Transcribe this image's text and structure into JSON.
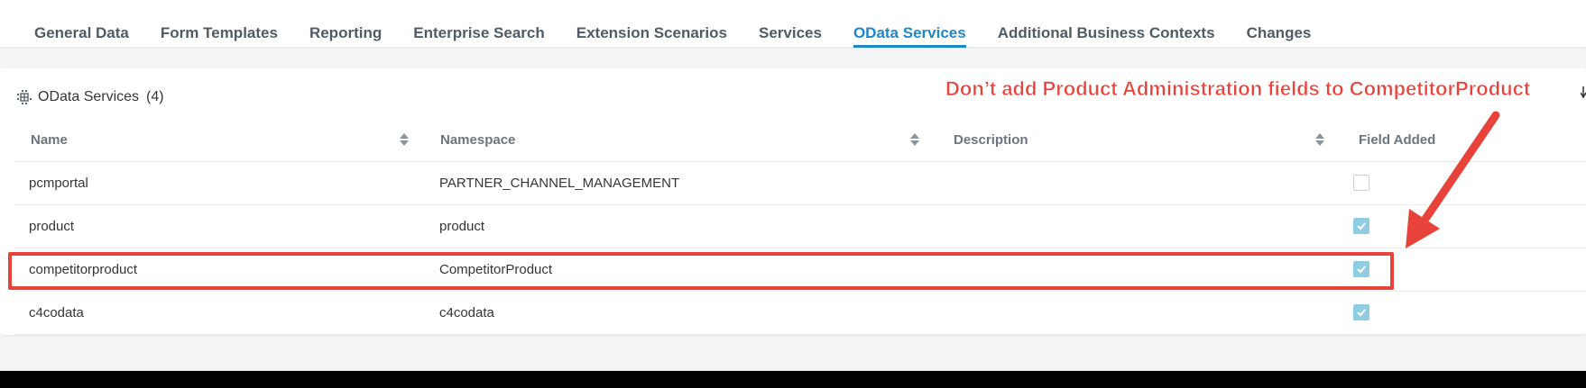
{
  "tabs": [
    {
      "label": "General Data",
      "active": false
    },
    {
      "label": "Form Templates",
      "active": false
    },
    {
      "label": "Reporting",
      "active": false
    },
    {
      "label": "Enterprise Search",
      "active": false
    },
    {
      "label": "Extension Scenarios",
      "active": false
    },
    {
      "label": "Services",
      "active": false
    },
    {
      "label": "OData Services",
      "active": true
    },
    {
      "label": "Additional Business Contexts",
      "active": false
    },
    {
      "label": "Changes",
      "active": false
    }
  ],
  "panel": {
    "icon": "grid-icon",
    "title": "OData Services",
    "count": "(4)"
  },
  "table": {
    "columns": [
      "Name",
      "Namespace",
      "Description",
      "Field Added"
    ],
    "rows": [
      {
        "name": "pcmportal",
        "namespace": "PARTNER_CHANNEL_MANAGEMENT",
        "description": "",
        "field_added": false
      },
      {
        "name": "product",
        "namespace": "product",
        "description": "",
        "field_added": true
      },
      {
        "name": "competitorproduct",
        "namespace": "CompetitorProduct",
        "description": "",
        "field_added": true
      },
      {
        "name": "c4codata",
        "namespace": "c4codata",
        "description": "",
        "field_added": true
      }
    ]
  },
  "annotation": {
    "text": "Don’t add Product Administration fields to CompetitorProduct",
    "color": "#e8433b"
  },
  "colors": {
    "accent": "#1e87c8",
    "checkbox_checked": "#8fcde2"
  }
}
